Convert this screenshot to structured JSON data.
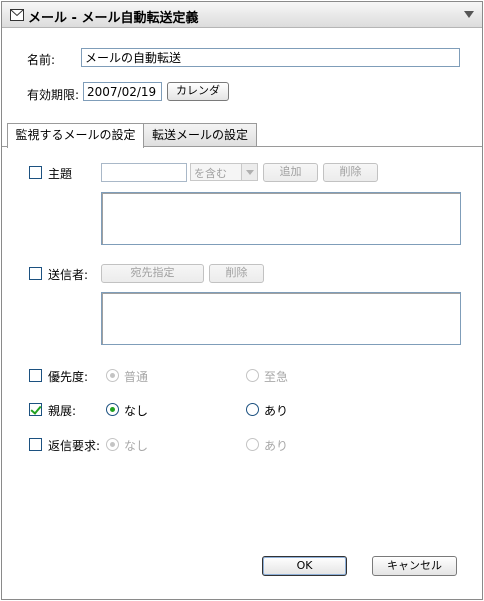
{
  "window": {
    "title": "メール - メール自動転送定義"
  },
  "form": {
    "name_label": "名前:",
    "name_value": "メールの自動転送",
    "validity_label": "有効期限:",
    "validity_value": "2007/02/19",
    "calendar_button": "カレンダ"
  },
  "tabs": [
    {
      "label": "監視するメールの設定",
      "active": true
    },
    {
      "label": "転送メールの設定",
      "active": false
    }
  ],
  "conditions": {
    "subject": {
      "label": "主題",
      "checked": false,
      "input_value": "",
      "operator_value": "を含む",
      "add_button": "追加",
      "delete_button": "削除",
      "list_value": ""
    },
    "sender": {
      "label": "送信者:",
      "checked": false,
      "address_button": "宛先指定",
      "delete_button": "削除",
      "list_value": ""
    },
    "priority": {
      "label": "優先度:",
      "checked": false,
      "options": [
        "普通",
        "至急"
      ],
      "selected": "普通"
    },
    "confidentiality": {
      "label": "親展:",
      "checked": true,
      "options": [
        "なし",
        "あり"
      ],
      "selected": "なし"
    },
    "reply_request": {
      "label": "返信要求:",
      "checked": false,
      "options": [
        "なし",
        "あり"
      ],
      "selected": "なし"
    }
  },
  "footer": {
    "ok_button": "OK",
    "cancel_button": "キャンセル"
  }
}
